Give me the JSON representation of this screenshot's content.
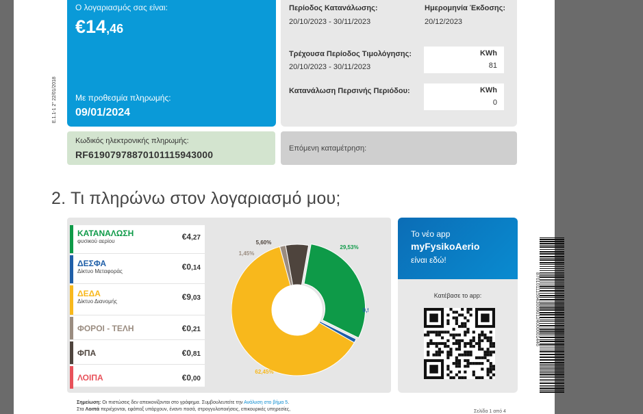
{
  "bill": {
    "label": "Ο λογαριασμός σας είναι:",
    "amount_main": "€14",
    "amount_cents": ",46",
    "due_label": "Με προθεσμία πληρωμής:",
    "due_date": "09/01/2024",
    "side_code": "E.1.1-1 2\" 22/01/2018"
  },
  "info": {
    "period_label": "Περίοδος Κατανάλωσης:",
    "period_value": "20/10/2023 - 30/11/2023",
    "issue_label": "Ημερομηνία Έκδοσης:",
    "issue_value": "20/12/2023",
    "current_label": "Τρέχουσα Περίοδος Τιμολόγησης:",
    "current_value": "20/10/2023 - 30/11/2023",
    "current_kwh_head": "KWh",
    "current_kwh": "81",
    "prev_label": "Κατανάλωση Περσινής Περιόδου:",
    "prev_kwh_head": "KWh",
    "prev_kwh": "0"
  },
  "payment": {
    "code_label": "Κωδικός ηλεκτρονικής πληρωμής:",
    "code": "RF61907978870101115943000",
    "next_reading_label": "Επόμενη καταμέτρηση:"
  },
  "section_title": "2.  Τι πληρώνω στον λογαριασμό μου;",
  "items": [
    {
      "name": "ΚΑΤΑΝΑΛΩΣΗ",
      "sub": "φυσικού αερίου",
      "euro": "€4",
      "cents": ",27",
      "color": "#0e9a48"
    },
    {
      "name": "ΔΕΣΦΑ",
      "sub": "Δίκτυο Μεταφοράς",
      "euro": "€0",
      "cents": ",14",
      "color": "#1f5fa8"
    },
    {
      "name": "ΔΕΔΑ",
      "sub": "Δίκτυο Διανομής",
      "euro": "€9",
      "cents": ",03",
      "color": "#f8b81c"
    },
    {
      "name": "ΦΟΡΟΙ - ΤΕΛΗ",
      "sub": "",
      "euro": "€0",
      "cents": ",21",
      "color": "#9a8c80"
    },
    {
      "name": "ΦΠΑ",
      "sub": "",
      "euro": "€0",
      "cents": ",81",
      "color": "#4e443d"
    },
    {
      "name": "ΛΟΙΠΑ",
      "sub": "",
      "euro": "€0",
      "cents": ",00",
      "color": "#e8515a"
    }
  ],
  "chart_data": {
    "type": "pie",
    "categories": [
      "ΚΑΤΑΝΑΛΩΣΗ",
      "ΔΕΣΦΑ",
      "ΔΕΔΑ",
      "ΦΟΡΟΙ - ΤΕΛΗ",
      "ΦΠΑ",
      "ΛΟΙΠΑ"
    ],
    "values": [
      29.53,
      0.97,
      62.45,
      1.45,
      5.6,
      0
    ],
    "labels": [
      "29,53%",
      "0,97%",
      "62,45%",
      "1,45%",
      "5,60%",
      ""
    ],
    "colors": [
      "#0e9a48",
      "#1f5fa8",
      "#f8b81c",
      "#9a8c80",
      "#4e443d",
      "#e8515a"
    ],
    "label_colors": [
      "#0e9a48",
      "#1f5fa8",
      "#f8b81c",
      "#9a8c80",
      "#4e443d",
      "#e8515a"
    ]
  },
  "app": {
    "line1": "Το νέο app",
    "line2": "myFysikoAerio",
    "line3": "είναι εδώ!",
    "download": "Κατέβασε το app:"
  },
  "barcode_text": "8701011159430090124000001446",
  "note": {
    "label": "Σημείωση:",
    "text1": " Οι πιστώσεις δεν απεικονίζονται στο γράφημα. Συμβουλευτείτε την ",
    "link": "Ανάλυση στο βήμα 5",
    "text1_end": ".",
    "text2_pre": "Στα ",
    "text2_bold": "Λοιπά",
    "text2": " περιέχονται, εφάπαξ υπάρχουν, έναντι ποσά, στρογγυλοποιήσεις, επικουρικές υπηρεσίες,"
  },
  "page_number": "Σελίδα 1 από 4"
}
